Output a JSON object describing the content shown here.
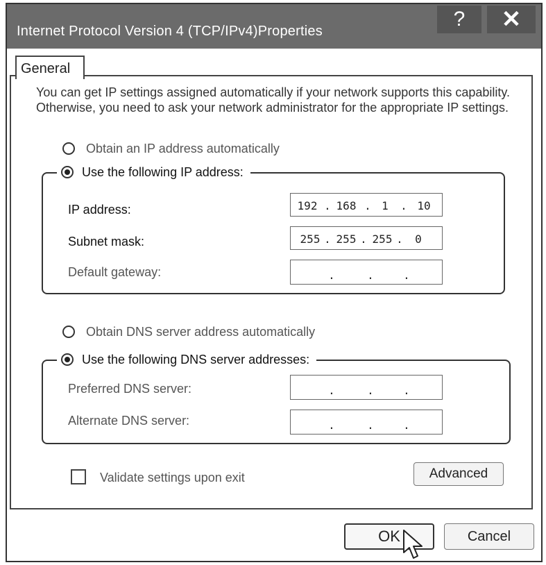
{
  "window": {
    "title": "Internet Protocol Version 4 (TCP/IPv4)Properties",
    "help_label": "?",
    "close_label": "✕"
  },
  "tabs": [
    {
      "label": "General"
    }
  ],
  "description": "You can get IP settings assigned automatically if your network supports this capability. Otherwise, you need to ask your network administrator for the appropriate IP settings.",
  "ip_section": {
    "auto_label": "Obtain an IP address automatically",
    "manual_label": "Use the following IP address:",
    "selected": "manual",
    "fields": [
      {
        "label": "IP address:",
        "segments": [
          "192",
          "168",
          "1",
          "10"
        ]
      },
      {
        "label": "Subnet mask:",
        "segments": [
          "255",
          "255",
          "255",
          "0"
        ]
      },
      {
        "label": "Default gateway:",
        "segments": [
          "",
          "",
          "",
          ""
        ]
      }
    ]
  },
  "dns_section": {
    "auto_label": "Obtain DNS  server address automatically",
    "manual_label": "Use the following DNS server addresses:",
    "selected": "manual",
    "fields": [
      {
        "label": "Preferred DNS server:",
        "segments": [
          "",
          "",
          "",
          ""
        ]
      },
      {
        "label": "Alternate DNS server:",
        "segments": [
          "",
          "",
          "",
          ""
        ]
      }
    ]
  },
  "validate": {
    "label": "Validate settings upon exit",
    "checked": false
  },
  "buttons": {
    "advanced": "Advanced",
    "ok": "OK",
    "cancel": "Cancel"
  },
  "icons": {
    "cursor": "pointer-cursor-icon"
  }
}
